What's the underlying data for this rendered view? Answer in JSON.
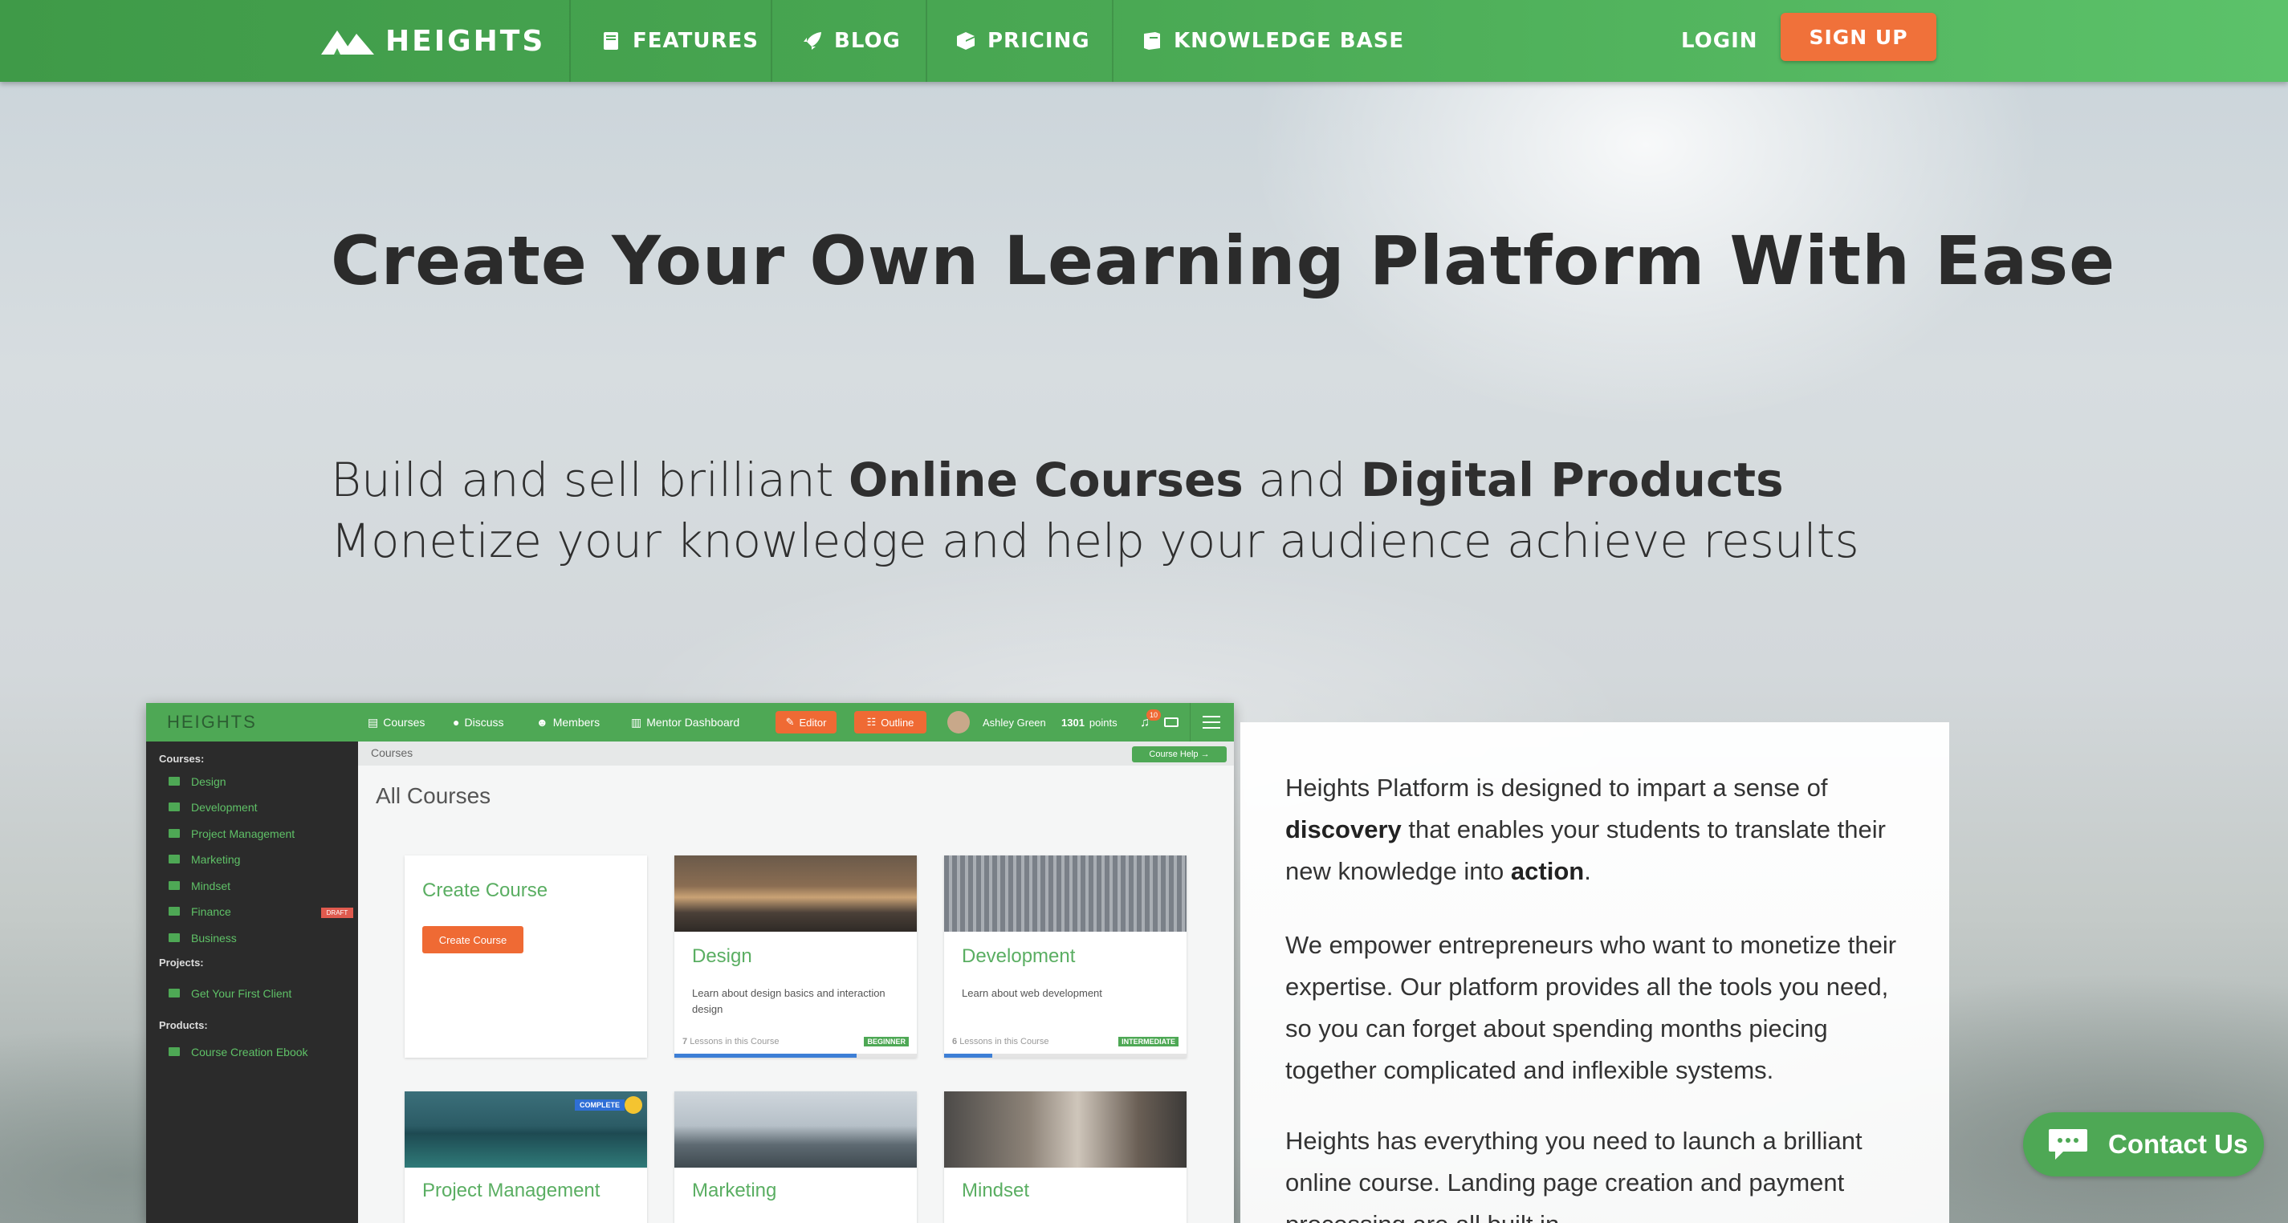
{
  "nav": {
    "brand": "HEIGHTS",
    "links": [
      "FEATURES",
      "BLOG",
      "PRICING",
      "KNOWLEDGE BASE"
    ],
    "login": "LOGIN",
    "signup": "SIGN UP"
  },
  "hero": {
    "headline": "Create Your Own Learning Platform With Ease",
    "sub1_a": "Build and sell brilliant ",
    "sub1_b": "Online Courses",
    "sub1_c": " and ",
    "sub1_d": "Digital Products",
    "sub2": "Monetize your knowledge and help your audience achieve results"
  },
  "mockup": {
    "brand": "HEIGHTS",
    "nav": [
      "Courses",
      "Discuss",
      "Members",
      "Mentor Dashboard"
    ],
    "editor": "Editor",
    "outline": "Outline",
    "user": "Ashley Green",
    "points": "1301",
    "points_label": "points",
    "notif_count": "10",
    "sidebar": {
      "courses_heading": "Courses:",
      "courses": [
        "Design",
        "Development",
        "Project Management",
        "Marketing",
        "Mindset",
        "Finance",
        "Business"
      ],
      "draft": "DRAFT",
      "projects_heading": "Projects:",
      "projects": [
        "Get Your First Client"
      ],
      "products_heading": "Products:",
      "products": [
        "Course Creation Ebook"
      ]
    },
    "breadcrumb": "Courses",
    "help": "Course Help",
    "all_courses": "All Courses",
    "create_course_title": "Create Course",
    "create_course_btn": "Create Course",
    "cards": [
      {
        "title": "Design",
        "desc": "Learn about design basics and interaction design",
        "lessons": "7",
        "lessons_label": "Lessons in this Course",
        "level": "BEGINNER",
        "progress": 0.75
      },
      {
        "title": "Development",
        "desc": "Learn about web development",
        "lessons": "6",
        "lessons_label": "Lessons in this Course",
        "level": "INTERMEDIATE",
        "progress": 0.2
      },
      {
        "title": "Project Management",
        "badge": "COMPLETE"
      },
      {
        "title": "Marketing"
      },
      {
        "title": "Mindset"
      }
    ]
  },
  "panel": {
    "p1_a": "Heights Platform is designed to impart a sense of ",
    "p1_b": "discovery",
    "p1_c": " that enables your students to translate their new knowledge into ",
    "p1_d": "action",
    "p1_e": ".",
    "p2": "We empower entrepreneurs who want to monetize their expertise. Our platform provides all the tools you need, so you can forget about spending months piecing together complicated and inflexible systems.",
    "p3": "Heights has everything you need to launch a brilliant online course. Landing page creation and payment processing are all built in."
  },
  "contact": "Contact Us",
  "colors": {
    "brand_green": "#4ea855",
    "accent_orange": "#f0713a"
  }
}
